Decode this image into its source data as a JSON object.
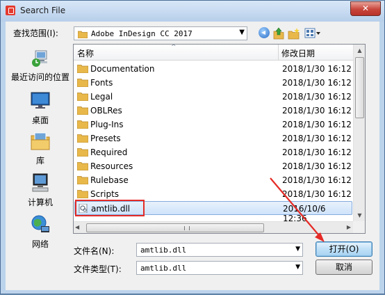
{
  "window": {
    "title": "Search File",
    "close_glyph": "✕"
  },
  "lookin": {
    "label": "查找范围(I):",
    "value": "Adobe InDesign CC 2017"
  },
  "places": [
    {
      "label": "最近访问的位置",
      "icon": "recent-places-icon"
    },
    {
      "label": "桌面",
      "icon": "desktop-icon"
    },
    {
      "label": "库",
      "icon": "libraries-icon"
    },
    {
      "label": "计算机",
      "icon": "computer-icon"
    },
    {
      "label": "网络",
      "icon": "network-icon"
    }
  ],
  "filelist": {
    "col_name": "名称",
    "col_date": "修改日期",
    "rows": [
      {
        "name": "Documentation",
        "date": "2018/1/30 16:12",
        "type": "folder"
      },
      {
        "name": "Fonts",
        "date": "2018/1/30 16:12",
        "type": "folder"
      },
      {
        "name": "Legal",
        "date": "2018/1/30 16:12",
        "type": "folder"
      },
      {
        "name": "OBLRes",
        "date": "2018/1/30 16:12",
        "type": "folder"
      },
      {
        "name": "Plug-Ins",
        "date": "2018/1/30 16:12",
        "type": "folder"
      },
      {
        "name": "Presets",
        "date": "2018/1/30 16:12",
        "type": "folder"
      },
      {
        "name": "Required",
        "date": "2018/1/30 16:12",
        "type": "folder"
      },
      {
        "name": "Resources",
        "date": "2018/1/30 16:12",
        "type": "folder"
      },
      {
        "name": "Rulebase",
        "date": "2018/1/30 16:12",
        "type": "folder"
      },
      {
        "name": "Scripts",
        "date": "2018/1/30 16:12",
        "type": "folder"
      },
      {
        "name": "amtlib.dll",
        "date": "2016/10/6 12:36",
        "type": "dll",
        "selected": true
      }
    ]
  },
  "filename": {
    "label": "文件名(N):",
    "value": "amtlib.dll"
  },
  "filetype": {
    "label": "文件类型(T):",
    "value": "amtlib.dll"
  },
  "buttons": {
    "open": "打开(O)",
    "cancel": "取消"
  },
  "colors": {
    "annotation": "#e52b26",
    "folder": "#e8b84a"
  }
}
